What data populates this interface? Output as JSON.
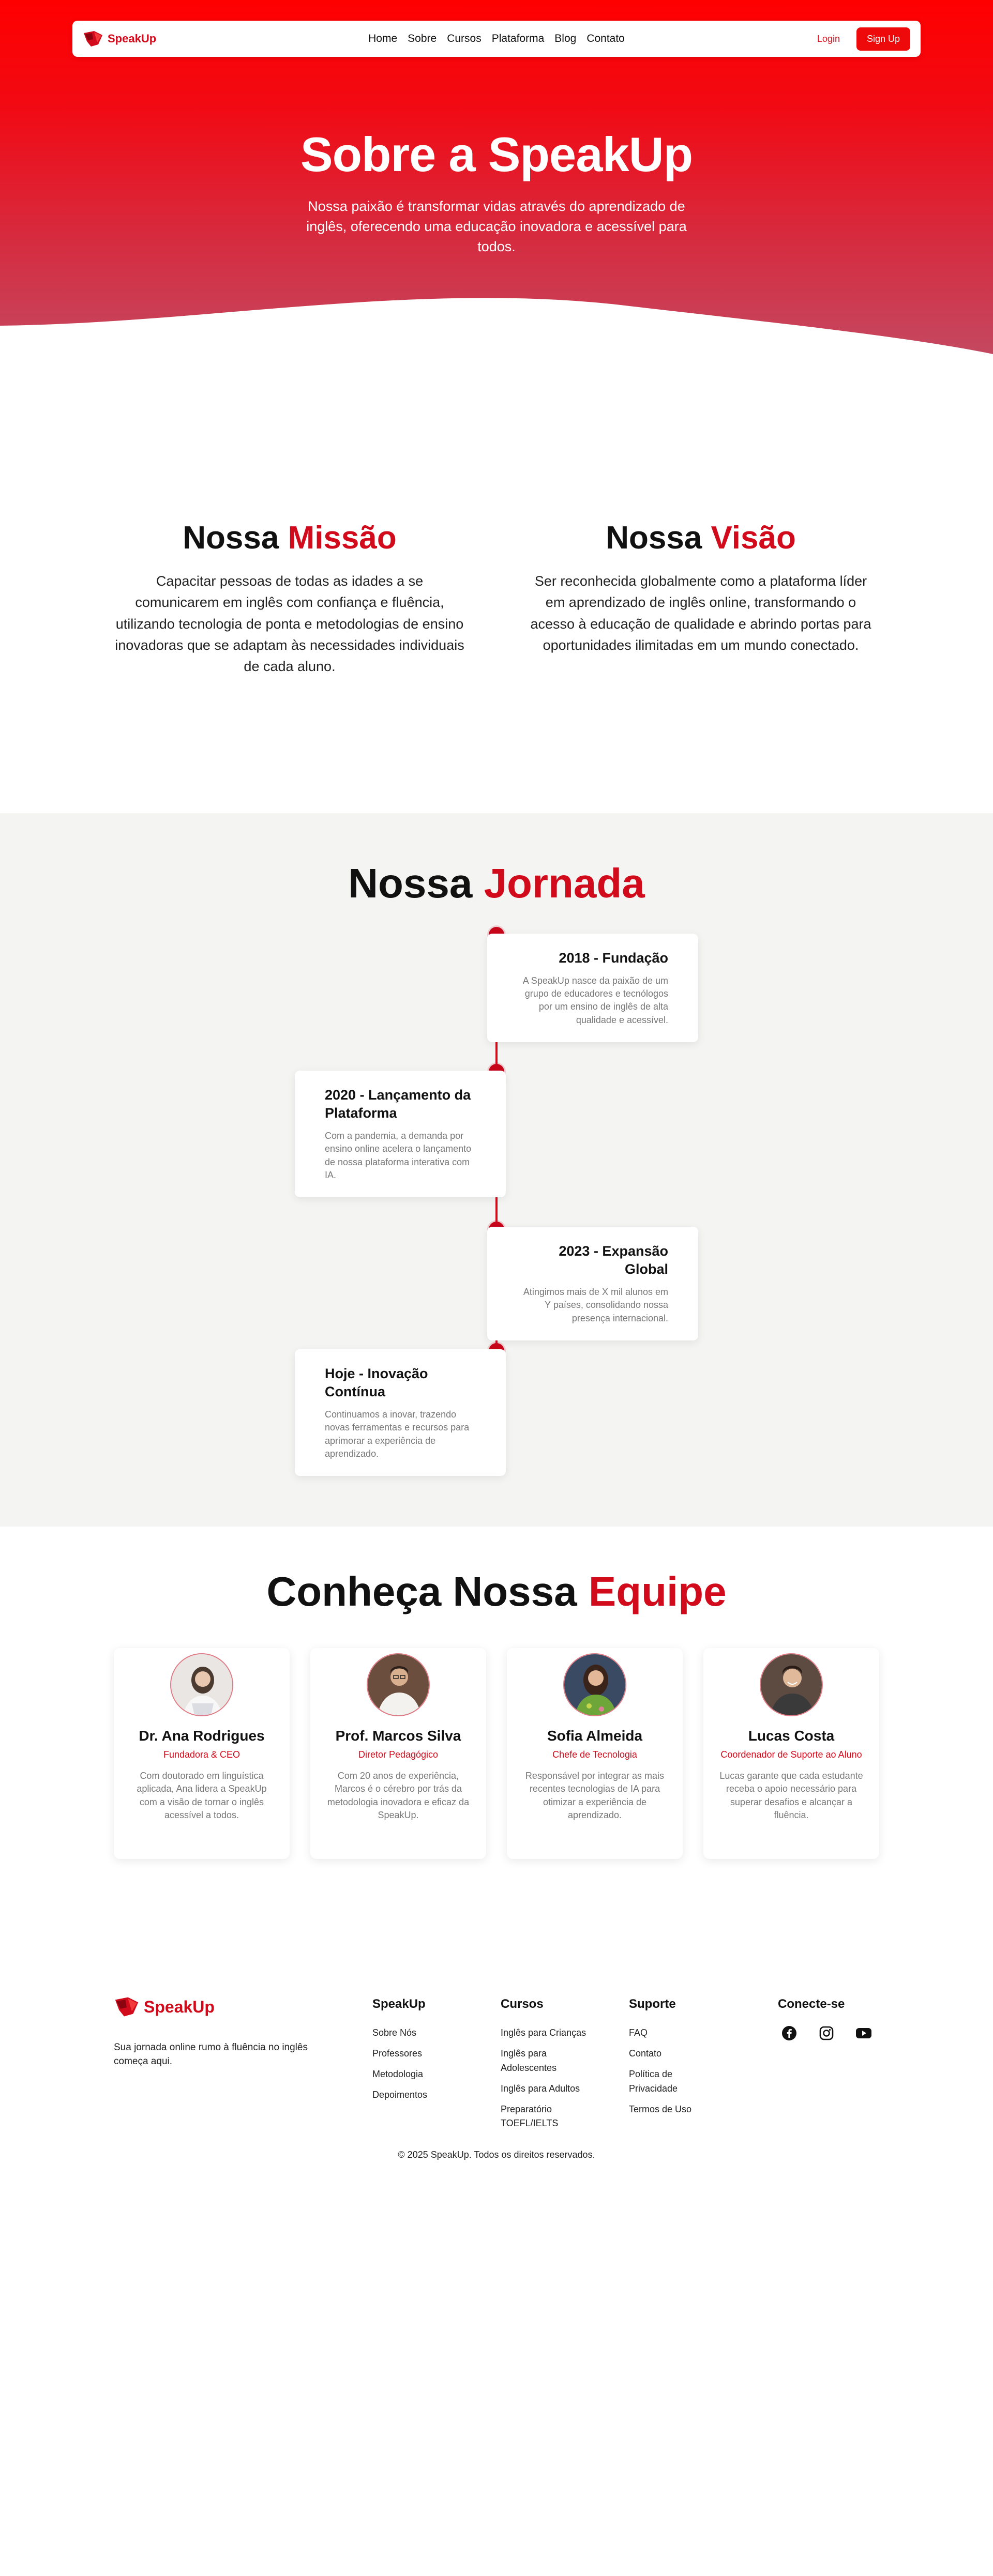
{
  "colors": {
    "primary": "#d10b1c",
    "hero_top": "#ff0000",
    "hero_bottom": "#c34a62",
    "section_gray": "#f4f4f2"
  },
  "header": {
    "brand": "SpeakUp",
    "nav": [
      "Home",
      "Sobre",
      "Cursos",
      "Plataforma",
      "Blog",
      "Contato"
    ],
    "login": "Login",
    "signup": "Sign Up"
  },
  "hero": {
    "title": "Sobre a SpeakUp",
    "subtitle": "Nossa paixão é transformar vidas através do aprendizado de inglês, oferecendo uma educação inovadora e acessível para todos."
  },
  "mission": {
    "word": "Nossa",
    "accent": "Missão",
    "text": "Capacitar pessoas de todas as idades a se comunicarem em inglês com confiança e fluência, utilizando tecnologia de ponta e metodologias de ensino inovadoras que se adaptam às necessidades individuais de cada aluno."
  },
  "vision": {
    "word": "Nossa",
    "accent": "Visão",
    "text": "Ser reconhecida globalmente como a plataforma líder em aprendizado de inglês online, transformando o acesso à educação de qualidade e abrindo portas para oportunidades ilimitadas em um mundo conectado."
  },
  "journey": {
    "word": "Nossa",
    "accent": "Jornada",
    "events": [
      {
        "title": "2018 - Fundação",
        "text": "A SpeakUp nasce da paixão de um grupo de educadores e tecnólogos por um ensino de inglês de alta qualidade e acessível."
      },
      {
        "title": "2020 - Lançamento da Plataforma",
        "text": "Com a pandemia, a demanda por ensino online acelera o lançamento de nossa plataforma interativa com IA."
      },
      {
        "title": "2023 - Expansão Global",
        "text": "Atingimos mais de X mil alunos em Y países, consolidando nossa presença internacional."
      },
      {
        "title": "Hoje - Inovação Contínua",
        "text": "Continuamos a inovar, trazendo novas ferramentas e recursos para aprimorar a experiência de aprendizado."
      }
    ]
  },
  "team": {
    "word": "Conheça Nossa",
    "accent": "Equipe",
    "members": [
      {
        "name": "Dr. Ana Rodrigues",
        "role": "Fundadora & CEO",
        "bio": "Com doutorado em linguística aplicada, Ana lidera a SpeakUp com a visão de tornar o inglês acessível a todos.",
        "avatar_icon": "woman-portrait"
      },
      {
        "name": "Prof. Marcos Silva",
        "role": "Diretor Pedagógico",
        "bio": "Com 20 anos de experiência, Marcos é o cérebro por trás da metodologia inovadora e eficaz da SpeakUp.",
        "avatar_icon": "man-portrait"
      },
      {
        "name": "Sofia Almeida",
        "role": "Chefe de Tecnologia",
        "bio": "Responsável por integrar as mais recentes tecnologias de IA para otimizar a experiência de aprendizado.",
        "avatar_icon": "woman-portrait"
      },
      {
        "name": "Lucas Costa",
        "role": "Coordenador de Suporte ao Aluno",
        "bio": "Lucas garante que cada estudante receba o apoio necessário para superar desafios e alcançar a fluência.",
        "avatar_icon": "man-portrait"
      }
    ]
  },
  "footer": {
    "brand": "SpeakUp",
    "tagline": "Sua jornada online rumo à fluência no inglês começa aqui.",
    "columns": [
      {
        "title": "SpeakUp",
        "links": [
          "Sobre Nós",
          "Professores",
          "Metodologia",
          "Depoimentos"
        ]
      },
      {
        "title": "Cursos",
        "links": [
          "Inglês para Crianças",
          "Inglês para Adolescentes",
          "Inglês para Adultos",
          "Preparatório TOEFL/IELTS"
        ]
      },
      {
        "title": "Suporte",
        "links": [
          "FAQ",
          "Contato",
          "Política de Privacidade",
          "Termos de Uso"
        ]
      }
    ],
    "social_title": "Conecte-se",
    "social_icons": [
      "facebook-icon",
      "instagram-icon",
      "youtube-icon"
    ],
    "copyright": "© 2025 SpeakUp. Todos os direitos reservados."
  }
}
